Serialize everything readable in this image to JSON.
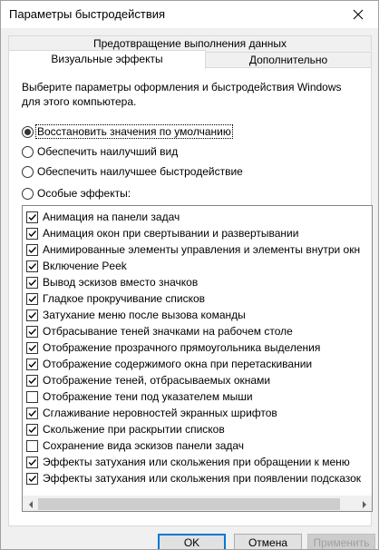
{
  "window": {
    "title": "Параметры быстродействия"
  },
  "tabs": {
    "top": "Предотвращение выполнения данных",
    "active": "Визуальные эффекты",
    "other": "Дополнительно"
  },
  "intro": "Выберите параметры оформления и быстродействия Windows для этого компьютера.",
  "radios": [
    {
      "label": "Восстановить значения по умолчанию",
      "checked": true
    },
    {
      "label": "Обеспечить наилучший вид",
      "checked": false
    },
    {
      "label": "Обеспечить наилучшее быстродействие",
      "checked": false
    },
    {
      "label": "Особые эффекты:",
      "checked": false
    }
  ],
  "effects": [
    {
      "label": "Анимация на панели задач",
      "checked": true
    },
    {
      "label": "Анимация окон при свертывании и развертывании",
      "checked": true
    },
    {
      "label": "Анимированные элементы управления и элементы внутри окн",
      "checked": true
    },
    {
      "label": "Включение Peek",
      "checked": true
    },
    {
      "label": "Вывод эскизов вместо значков",
      "checked": true
    },
    {
      "label": "Гладкое прокручивание списков",
      "checked": true
    },
    {
      "label": "Затухание меню после вызова команды",
      "checked": true
    },
    {
      "label": "Отбрасывание теней значками на рабочем столе",
      "checked": true
    },
    {
      "label": "Отображение прозрачного прямоугольника выделения",
      "checked": true
    },
    {
      "label": "Отображение содержимого окна при перетаскивании",
      "checked": true
    },
    {
      "label": "Отображение теней, отбрасываемых окнами",
      "checked": true
    },
    {
      "label": "Отображение тени под указателем мыши",
      "checked": false
    },
    {
      "label": "Сглаживание неровностей экранных шрифтов",
      "checked": true
    },
    {
      "label": "Скольжение при раскрытии списков",
      "checked": true
    },
    {
      "label": "Сохранение вида эскизов панели задач",
      "checked": false
    },
    {
      "label": "Эффекты затухания или скольжения при обращении к меню",
      "checked": true
    },
    {
      "label": "Эффекты затухания или скольжения при появлении подсказок",
      "checked": true
    }
  ],
  "buttons": {
    "ok": "OK",
    "cancel": "Отмена",
    "apply": "Применить"
  }
}
